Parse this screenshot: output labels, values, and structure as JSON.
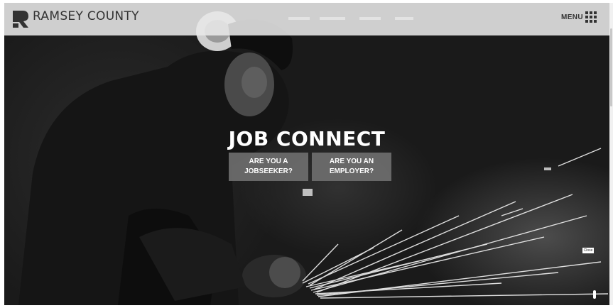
{
  "header": {
    "brand_name": "RAMSEY COUNTY",
    "menu_label": "MENU",
    "logo_icon": "ramsey-r-logo-icon",
    "menu_icon": "grid-menu-icon"
  },
  "hero": {
    "title": "JOB CONNECT",
    "jobseeker_button": {
      "line1": "ARE YOU A",
      "line2": "JOBSEEKER?"
    },
    "employer_button": {
      "line1": "ARE YOU AN",
      "line2": "EMPLOYER?"
    },
    "close_label": "Close"
  },
  "colors": {
    "header_bg": "#e8e8e8",
    "header_text": "#333333",
    "button_bg": "#6e6e6e",
    "button_text": "#ffffff",
    "title_text": "#ffffff"
  }
}
